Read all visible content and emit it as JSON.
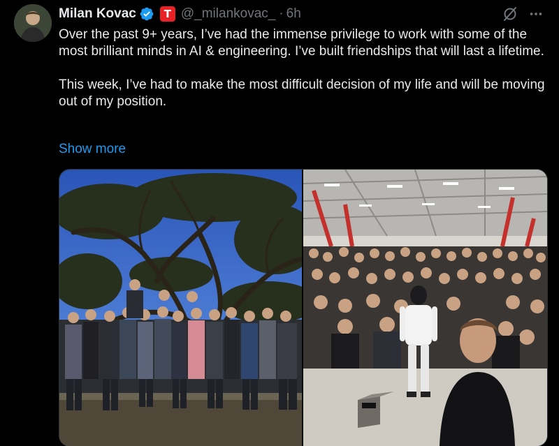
{
  "author": {
    "display_name": "Milan Kovac",
    "handle": "@_milankovac_",
    "separator": "·",
    "time": "6h",
    "affiliation_letter": "T",
    "affiliation_color": "#e82127",
    "verified_color": "#1d9bf0"
  },
  "tweet": {
    "paragraph_1": "Over the past 9+ years, I’ve had the immense privilege to work with some of the most brilliant minds in AI & engineering. I’ve built friendships that will last a lifetime.",
    "paragraph_2": "This week, I’ve had to make the most difficult decision of my life and will be moving out of my position.",
    "show_more": "Show more"
  },
  "icons": {
    "grok": "grok-icon",
    "more": "more-options-icon"
  },
  "media": {
    "count": 2
  },
  "colors": {
    "background": "#000000",
    "text": "#e7e9ea",
    "secondary": "#71767b",
    "link": "#1d9bf0"
  }
}
